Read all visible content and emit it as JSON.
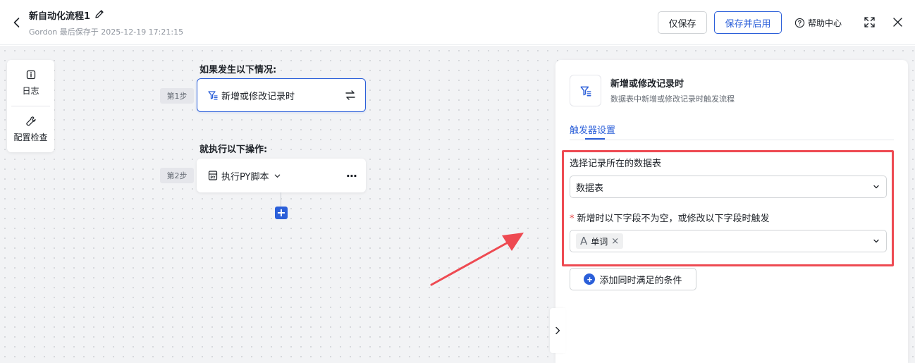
{
  "header": {
    "title": "新自动化流程1",
    "subtitle": "Gordon 最后保存于 2025-12-19 17:21:15",
    "save_label": "仅保存",
    "save_enable_label": "保存并启用",
    "help_label": "帮助中心"
  },
  "tools": {
    "log_label": "日志",
    "check_label": "配置检查"
  },
  "flow": {
    "if_label": "如果发生以下情况:",
    "then_label": "就执行以下操作:",
    "step1_tag": "第1步",
    "step2_tag": "第2步",
    "trigger_label": "新增或修改记录时",
    "action_label": "执行PY脚本",
    "more_label": "···",
    "add_label": "+"
  },
  "panel": {
    "title": "新增或修改记录时",
    "description": "数据表中新增或修改记录时触发流程",
    "tab_label": "触发器设置",
    "table_field_label": "选择记录所在的数据表",
    "table_value": "数据表",
    "fields_label": "新增时以下字段不为空，或修改以下字段时触发",
    "required_star": "*",
    "field_tag": "单词",
    "field_tag_icon": "A",
    "field_tag_remove": "×",
    "add_condition_label": "添加同时满足的条件",
    "add_condition_plus": "+"
  },
  "colors": {
    "accent": "#2b5fd9",
    "highlight": "#ee4a52",
    "canvas_bg": "#f2f3f5"
  },
  "icons": [
    "back-arrow-icon",
    "pencil-icon",
    "help-circle-icon",
    "expand-icon",
    "close-icon",
    "info-icon",
    "wrench-icon",
    "filter-icon",
    "swap-icon",
    "py-file-icon",
    "chevron-down-icon",
    "more-dots-icon",
    "plus-icon",
    "chevron-right-icon"
  ]
}
